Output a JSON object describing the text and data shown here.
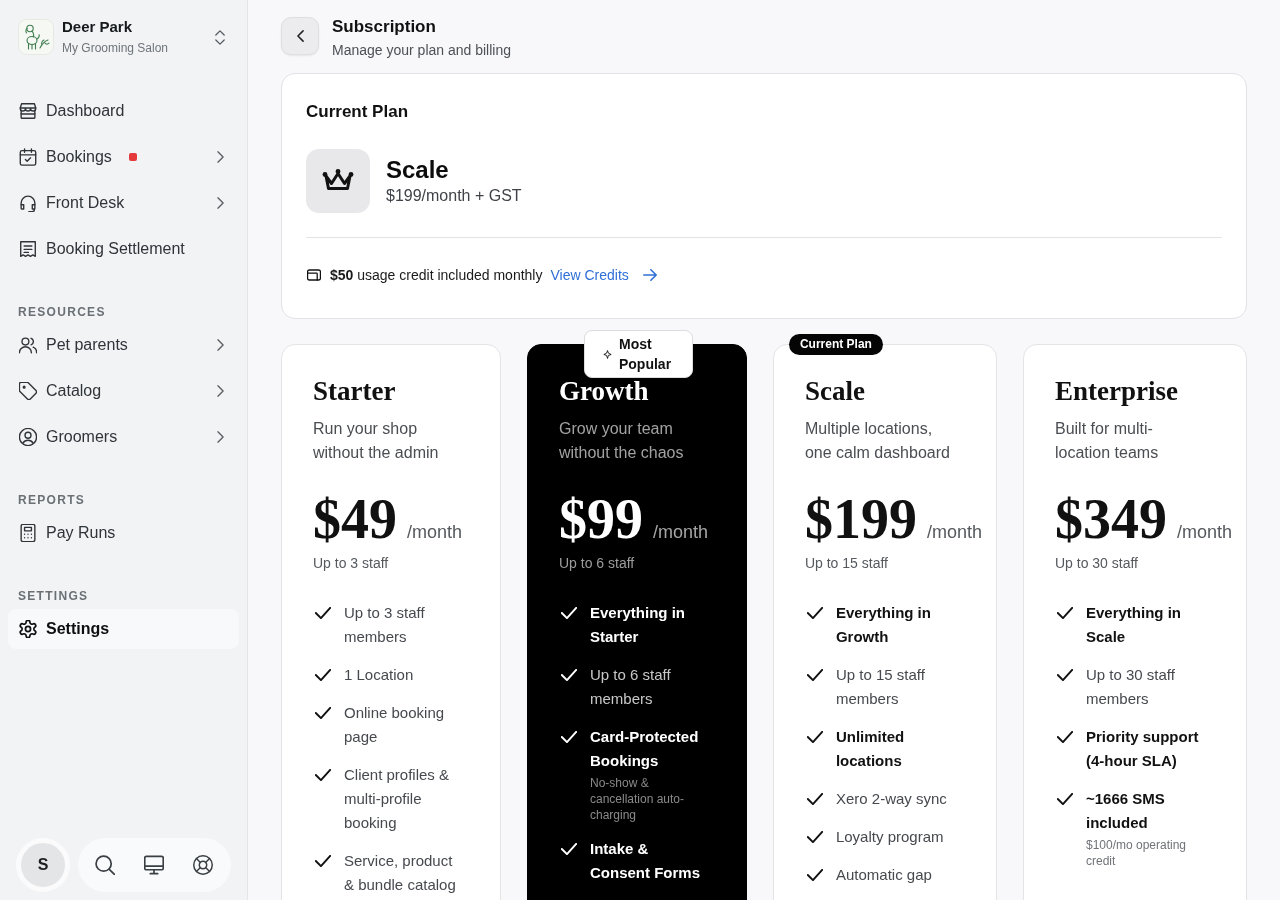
{
  "sidebar": {
    "workspace": {
      "name": "Deer Park",
      "subtitle": "My Grooming Salon"
    },
    "sections": [
      {
        "items": [
          {
            "label": "Dashboard",
            "selected": false,
            "expandable": false,
            "alert": false
          },
          {
            "label": "Bookings",
            "selected": false,
            "expandable": true,
            "alert": true
          },
          {
            "label": "Front Desk",
            "selected": false,
            "expandable": true,
            "alert": false
          },
          {
            "label": "Booking Settlement",
            "selected": false,
            "expandable": false,
            "alert": false
          }
        ]
      },
      {
        "heading": "RESOURCES",
        "items": [
          {
            "label": "Pet parents",
            "selected": false,
            "expandable": true,
            "alert": false
          },
          {
            "label": "Catalog",
            "selected": false,
            "expandable": true,
            "alert": false
          },
          {
            "label": "Groomers",
            "selected": false,
            "expandable": true,
            "alert": false
          }
        ]
      },
      {
        "heading": "REPORTS",
        "items": [
          {
            "label": "Pay Runs",
            "selected": false,
            "expandable": false,
            "alert": false
          }
        ]
      },
      {
        "heading": "SETTINGS",
        "items": [
          {
            "label": "Settings",
            "selected": true,
            "expandable": false,
            "alert": false
          }
        ]
      }
    ],
    "user": {
      "initial": "S"
    }
  },
  "header": {
    "title": "Subscription",
    "subtitle": "Manage your plan and billing"
  },
  "current_plan": {
    "heading": "Current Plan",
    "name": "Scale",
    "price": "$199/month + GST",
    "credit": {
      "text": "**$50** usage credit included monthly",
      "link": "View Credits"
    }
  },
  "plans": [
    {
      "name": "Starter",
      "description": "Run your shop without the admin",
      "price": "$49",
      "period": "/month",
      "staff": "Up to 3 staff",
      "featured": false,
      "features": [
        {
          "text": "Up to 3 staff members",
          "emphasis": false
        },
        {
          "text": "1 Location",
          "emphasis": false
        },
        {
          "text": "Online booking page",
          "emphasis": false
        },
        {
          "text": "Client profiles & multi-profile booking",
          "emphasis": false
        },
        {
          "text": "Service, product & bundle catalog",
          "emphasis": false
        }
      ]
    },
    {
      "name": "Growth",
      "description": "Grow your team without the chaos",
      "price": "$99",
      "period": "/month",
      "staff": "Up to 6 staff",
      "featured": true,
      "badge": {
        "kind": "popular",
        "label": "Most Popular"
      },
      "features": [
        {
          "text": "Everything in Starter",
          "emphasis": true
        },
        {
          "text": "Up to 6 staff members",
          "emphasis": false
        },
        {
          "text": "Card-Protected Bookings",
          "emphasis": true,
          "note": "No-show & cancellation auto-charging"
        },
        {
          "text": "Intake & Consent Forms",
          "emphasis": true
        }
      ]
    },
    {
      "name": "Scale",
      "description": "Multiple locations, one calm dashboard",
      "price": "$199",
      "period": "/month",
      "staff": "Up to 15 staff",
      "featured": false,
      "badge": {
        "kind": "current",
        "label": "Current Plan"
      },
      "features": [
        {
          "text": "Everything in Growth",
          "emphasis": true
        },
        {
          "text": "Up to 15 staff members",
          "emphasis": false
        },
        {
          "text": "Unlimited locations",
          "emphasis": true
        },
        {
          "text": "Xero 2-way sync",
          "emphasis": false
        },
        {
          "text": "Loyalty program",
          "emphasis": false
        },
        {
          "text": "Automatic gap",
          "emphasis": false
        }
      ]
    },
    {
      "name": "Enterprise",
      "description": "Built for multi-location teams",
      "price": "$349",
      "period": "/month",
      "staff": "Up to 30 staff",
      "featured": false,
      "features": [
        {
          "text": "Everything in Scale",
          "emphasis": true
        },
        {
          "text": "Up to 30 staff members",
          "emphasis": false
        },
        {
          "text": "Priority support (4-hour SLA)",
          "emphasis": true
        },
        {
          "text": "~1666 SMS included",
          "emphasis": true,
          "note": "$100/mo operating credit"
        }
      ]
    }
  ]
}
